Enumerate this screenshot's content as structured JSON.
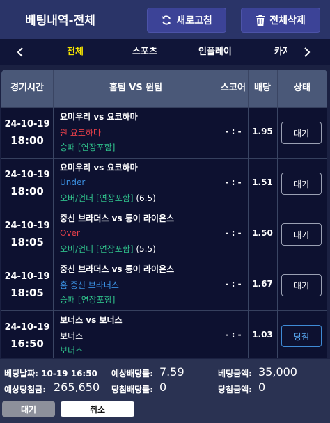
{
  "header": {
    "title": "베팅내역-전체",
    "refresh_label": "새로고침",
    "delete_all_label": "전체삭제"
  },
  "tabs": [
    {
      "label": "전체",
      "active": true
    },
    {
      "label": "스포츠",
      "active": false
    },
    {
      "label": "인플레이",
      "active": false
    },
    {
      "label": "카지노",
      "active": false
    }
  ],
  "table": {
    "columns": [
      "경기시간",
      "홈팀 VS 원팀",
      "스코어",
      "배당",
      "상태"
    ],
    "rows": [
      {
        "date": "24-10-19",
        "time": "18:00",
        "match": "요미우리 vs 요코하마",
        "pick": "원 요코하마",
        "pick_color": "#e8404a",
        "market": "승패 [연장포함]",
        "score": "- : -",
        "odds": "1.95",
        "status": "대기",
        "status_type": "wait"
      },
      {
        "date": "24-10-19",
        "time": "18:00",
        "match": "요미우리 vs 요코하마",
        "pick": "Under",
        "pick_color": "#3a8fe0",
        "market": "오버/언더 [연장포함]",
        "market_extra": " (6.5)",
        "score": "- : -",
        "odds": "1.51",
        "status": "대기",
        "status_type": "wait"
      },
      {
        "date": "24-10-19",
        "time": "18:05",
        "match": "중신 브라더스 vs 퉁이 라이온스",
        "pick": "Over",
        "pick_color": "#e8404a",
        "market": "오버/언더 [연장포함]",
        "market_extra": " (5.5)",
        "score": "- : -",
        "odds": "1.50",
        "status": "대기",
        "status_type": "wait"
      },
      {
        "date": "24-10-19",
        "time": "18:05",
        "match": "중신 브라더스 vs 퉁이 라이온스",
        "pick": "홈 중신 브라더스",
        "pick_color": "#3a8fe0",
        "market": "승패 [연장포함]",
        "score": "- : -",
        "odds": "1.67",
        "status": "대기",
        "status_type": "wait"
      },
      {
        "date": "24-10-19",
        "time": "16:50",
        "match": "보너스 vs 보너스",
        "pick": "보너스",
        "pick_color": "#ffffff",
        "market": "보너스",
        "market_color": "#2fbf8a",
        "score": "- : -",
        "odds": "1.03",
        "status": "당첨",
        "status_type": "win"
      }
    ]
  },
  "footer": {
    "bet_date_label": "베팅날짜:",
    "bet_date_value": "10-19 16:50",
    "expected_odds_label": "예상배당률:",
    "expected_odds_value": "7.59",
    "bet_amount_label": "베팅금액:",
    "bet_amount_value": "35,000",
    "expected_win_label": "예상당첨금:",
    "expected_win_value": "265,650",
    "win_odds_label": "당첨배당률:",
    "win_odds_value": "0",
    "win_amount_label": "당첨금액:",
    "win_amount_value": "0",
    "wait_button": "대기",
    "cancel_button": "취소"
  }
}
